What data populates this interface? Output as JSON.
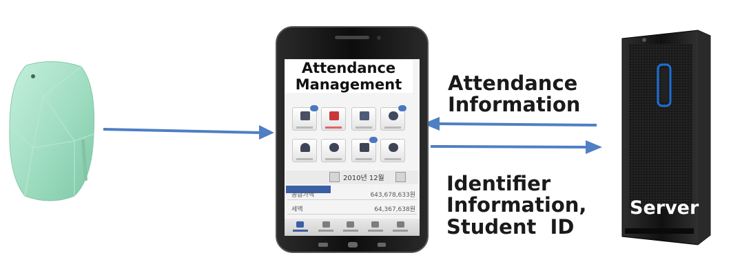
{
  "app": {
    "title_line1": "Attendance",
    "title_line2": "Management"
  },
  "labels": {
    "attendance_info_line1": "Attendance",
    "attendance_info_line2": "Information",
    "identifier_line1": "Identifier",
    "identifier_line2": "Information,",
    "identifier_line3": "Student  ID",
    "server": "Server"
  },
  "screen": {
    "date_text": "2010년 12월",
    "rows": [
      {
        "label": "공급가액",
        "value": "643,678,633원"
      },
      {
        "label": "세액",
        "value": "64,367,638원"
      }
    ]
  },
  "colors": {
    "arrow": "#4f7fc4",
    "beacon": "#a9e3c9",
    "server_body": "#141414"
  }
}
